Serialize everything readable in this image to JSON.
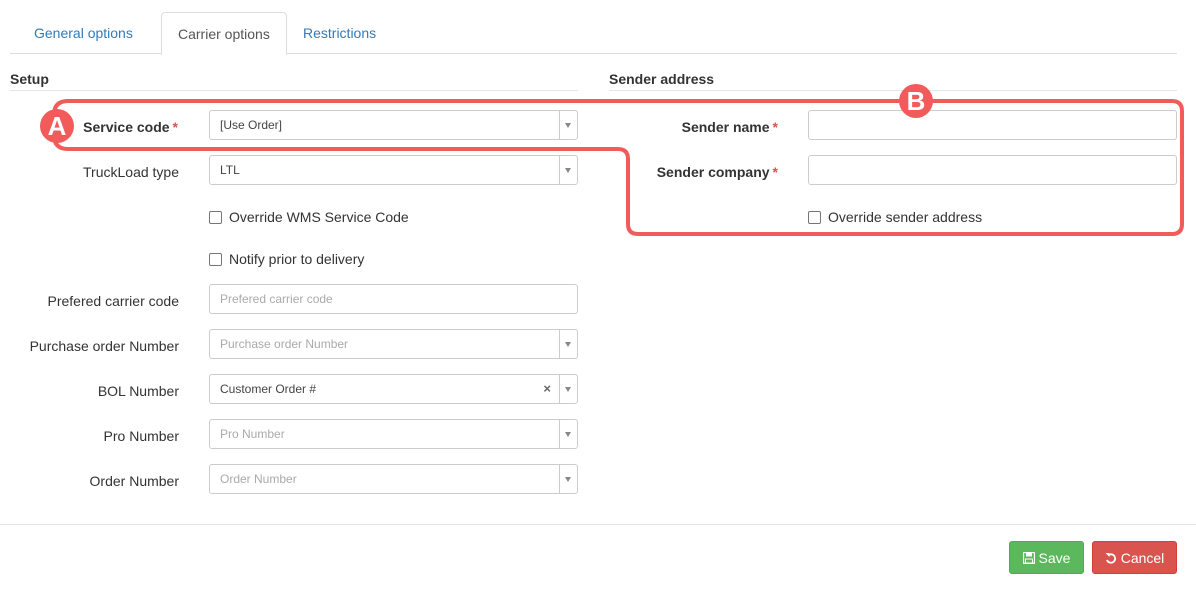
{
  "tabs": [
    {
      "label": "General options",
      "active": false
    },
    {
      "label": "Carrier options",
      "active": true
    },
    {
      "label": "Restrictions",
      "active": false
    }
  ],
  "setup": {
    "title": "Setup",
    "service_code": {
      "label": "Service code",
      "required": "*",
      "value": "[Use Order]"
    },
    "truckload_type": {
      "label": "TruckLoad type",
      "value": "LTL"
    },
    "override_wms": {
      "label": "Override WMS Service Code",
      "checked": false
    },
    "notify_prior": {
      "label": "Notify prior to delivery",
      "checked": false
    },
    "prefered_carrier_code": {
      "label": "Prefered carrier code",
      "placeholder": "Prefered carrier code",
      "value": ""
    },
    "purchase_order_number": {
      "label": "Purchase order Number",
      "placeholder": "Purchase order Number"
    },
    "bol_number": {
      "label": "BOL Number",
      "value": "Customer Order #",
      "clear": "×"
    },
    "pro_number": {
      "label": "Pro Number",
      "placeholder": "Pro Number"
    },
    "order_number": {
      "label": "Order Number",
      "placeholder": "Order Number"
    }
  },
  "sender": {
    "title": "Sender address",
    "sender_name": {
      "label": "Sender name",
      "required": "*",
      "value": ""
    },
    "sender_company": {
      "label": "Sender company",
      "required": "*",
      "value": ""
    },
    "override_sender": {
      "label": "Override sender address",
      "checked": false
    }
  },
  "annotations": {
    "marker_a": "A",
    "marker_b": "B",
    "color": "#f25b5b"
  },
  "footer": {
    "save_label": "Save",
    "cancel_label": "Cancel",
    "save_color": "#5cb85c",
    "cancel_color": "#d9534f"
  }
}
